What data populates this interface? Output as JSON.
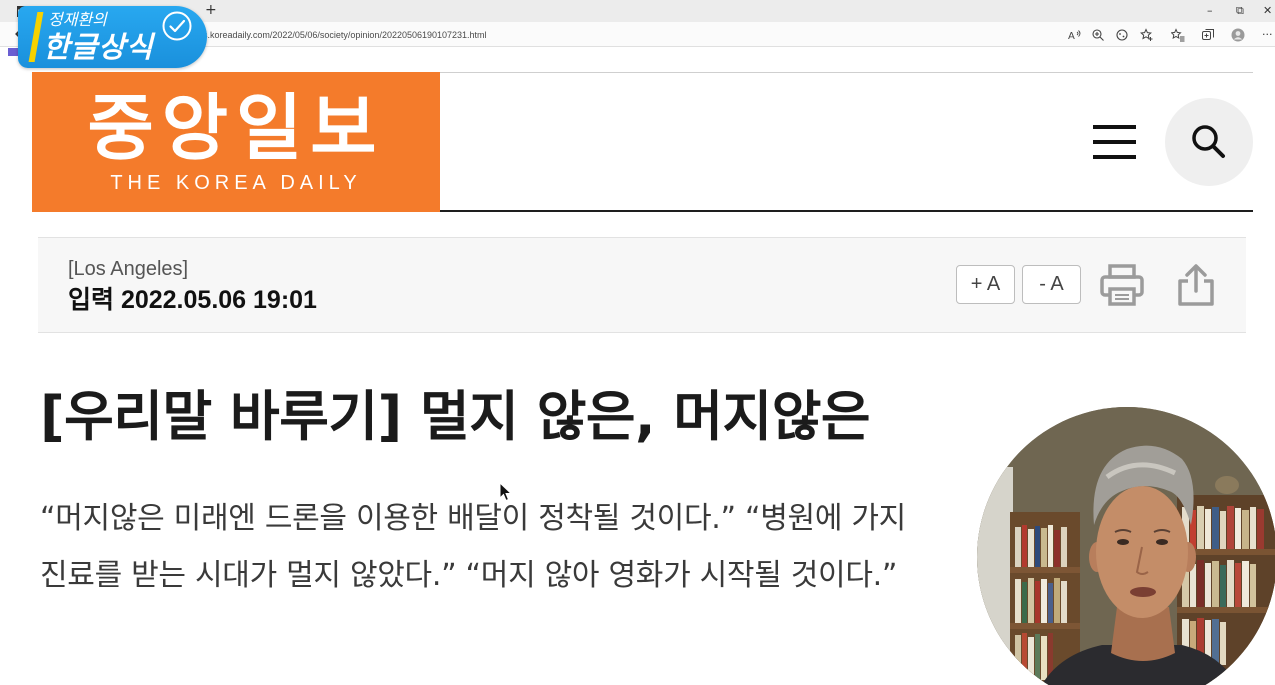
{
  "browser": {
    "url": "s.koreadaily.com/2022/05/06/society/opinion/20220506190107231.html",
    "new_tab_label": "+",
    "window_controls": {
      "minimize": "–",
      "restore": "⧉",
      "close": "✕"
    },
    "more_label": "···",
    "icons": {
      "tab_actions": "tab-actions-icon",
      "back": "back-arrow-icon",
      "read_aloud": "read-aloud-icon",
      "zoom": "zoom-icon",
      "tracking": "tracking-prevention-icon",
      "add_favorite": "add-favorite-star-icon",
      "favorites": "favorites-icon",
      "collections": "collections-icon",
      "profile": "profile-avatar-icon"
    }
  },
  "channel_badge": {
    "series": "정재환의",
    "title": "한글상식",
    "accent_color": "#1e9fea",
    "bar_color": "#f6d200",
    "icon": "check-circle-icon"
  },
  "site_header": {
    "logo_korean": "중앙일보",
    "logo_english": "THE KOREA DAILY",
    "brand_color": "#f47b2b",
    "menu_icon": "hamburger-menu-icon",
    "search_icon": "search-icon"
  },
  "article_meta": {
    "location": "[Los Angeles]",
    "published": "입력 2022.05.06 19:01",
    "font_increase_label": "+ A",
    "font_decrease_label": "- A",
    "print_icon": "print-icon",
    "share_icon": "share-icon"
  },
  "article": {
    "title": "[우리말 바루기] 멀지 않은, 머지않은",
    "lines": [
      "“머지않은 미래엔 드론을 이용한 배달이 정착될 것이다.” “병원에 가지",
      "진료를 받는 시대가 멀지 않았다.” “머지 않아 영화가 시작될 것이다.”"
    ]
  },
  "overlay": {
    "cursor_icon": "mouse-cursor-icon",
    "webcam": "presenter-webcam"
  }
}
